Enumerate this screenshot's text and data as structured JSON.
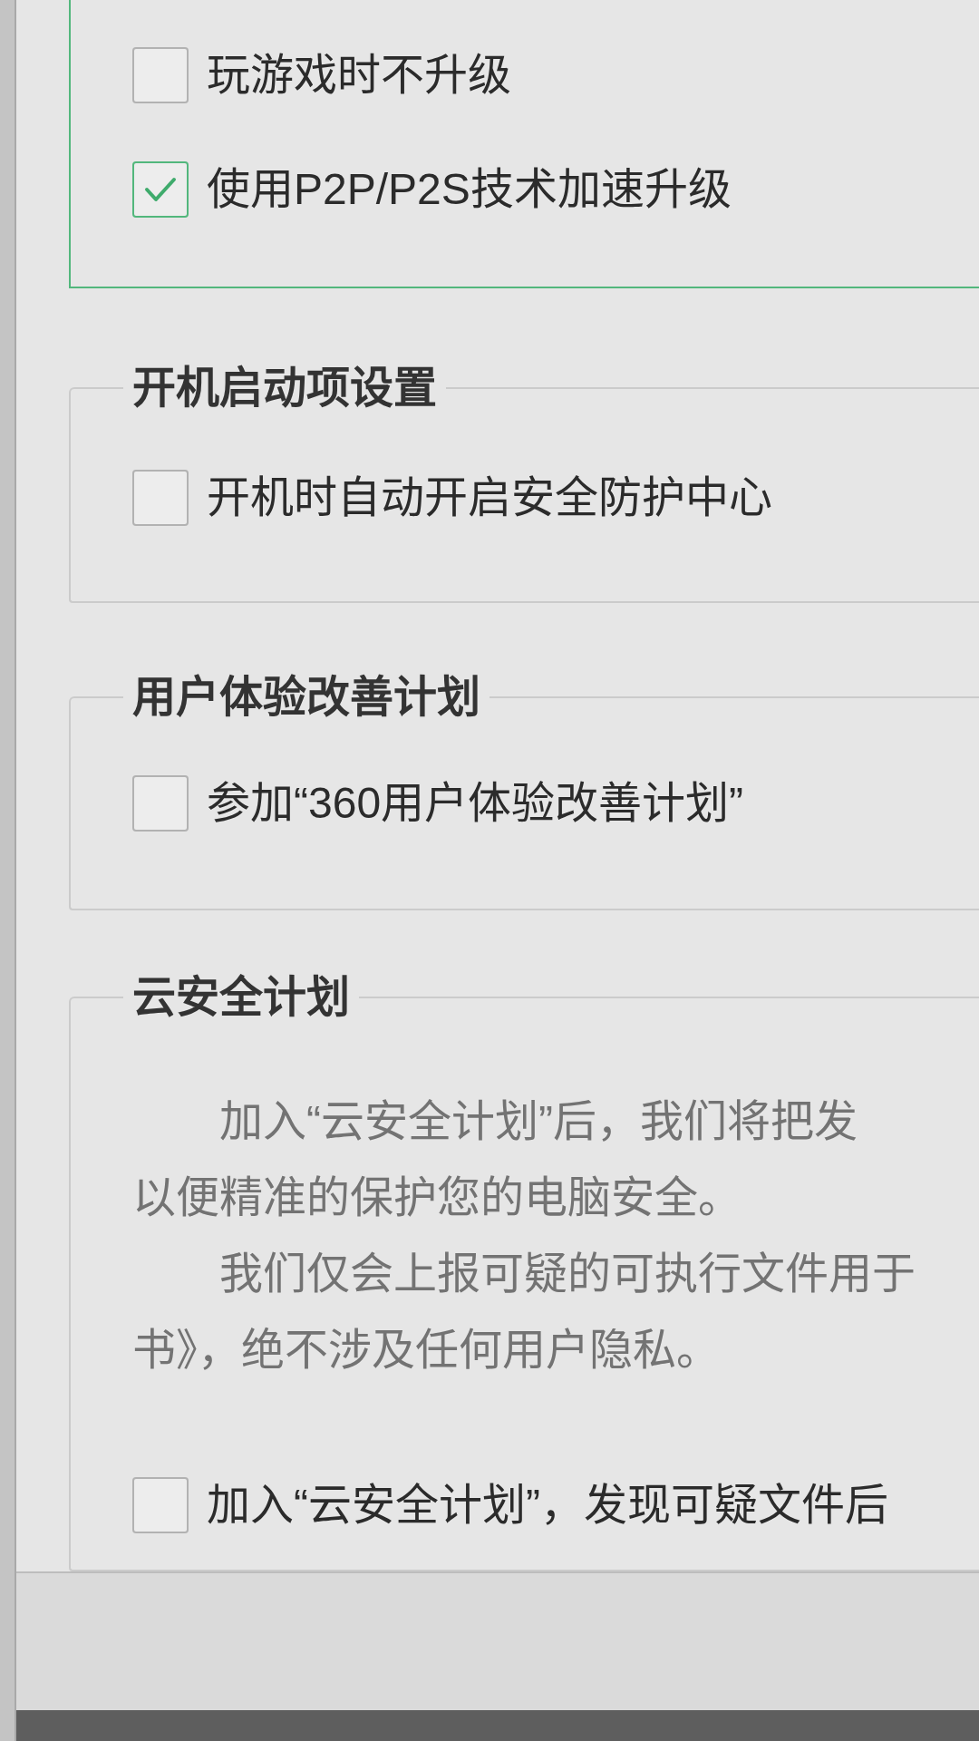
{
  "update_panel": {
    "options": [
      {
        "label": "玩游戏时不升级",
        "checked": false
      },
      {
        "label": "使用P2P/P2S技术加速升级",
        "checked": true
      }
    ]
  },
  "sections": [
    {
      "title": "开机启动项设置",
      "options": [
        {
          "label": "开机时自动开启安全防护中心",
          "checked": false
        }
      ]
    },
    {
      "title": "用户体验改善计划",
      "options": [
        {
          "label": "参加“360用户体验改善计划”",
          "checked": false
        }
      ]
    },
    {
      "title": "云安全计划",
      "paragraphs": [
        {
          "lines": [
            "加入“云安全计划”后，我们将把发",
            "以便精准的保护您的电脑安全。"
          ]
        },
        {
          "lines": [
            "我们仅会上报可疑的可执行文件用于",
            "书》，绝不涉及任何用户隐私。"
          ]
        }
      ],
      "options": [
        {
          "label": "加入“云安全计划”，发现可疑文件后",
          "checked": false
        }
      ]
    }
  ]
}
